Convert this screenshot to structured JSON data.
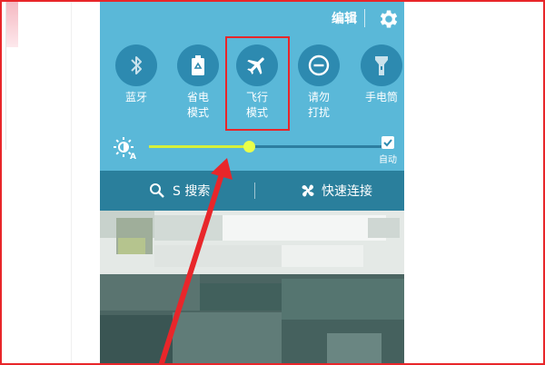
{
  "header": {
    "edit_label": "编辑"
  },
  "tiles": [
    {
      "name": "bluetooth",
      "label_lines": [
        "蓝牙"
      ]
    },
    {
      "name": "power-saving",
      "label_lines": [
        "省电",
        "模式"
      ]
    },
    {
      "name": "airplane-mode",
      "label_lines": [
        "飞行",
        "模式"
      ],
      "highlighted": true
    },
    {
      "name": "do-not-disturb",
      "label_lines": [
        "请勿",
        "打扰"
      ]
    },
    {
      "name": "flashlight",
      "label_lines": [
        "手电筒"
      ]
    }
  ],
  "brightness": {
    "level": 0.42,
    "auto_label": "自动",
    "auto_checked": true
  },
  "actions": {
    "search_label": "S 搜索",
    "quick_connect_label": "快速连接"
  },
  "colors": {
    "panel": "#5ab8d8",
    "tile": "#2d8ab0",
    "action_bar": "#2a7f9c",
    "accent": "#d6f03a",
    "annotation": "#e8262a"
  },
  "icons": [
    "gear-icon",
    "bluetooth-icon",
    "battery-recycle-icon",
    "airplane-icon",
    "minus-circle-icon",
    "flashlight-icon",
    "brightness-icon",
    "search-icon",
    "quick-connect-icon",
    "checkbox-icon"
  ]
}
